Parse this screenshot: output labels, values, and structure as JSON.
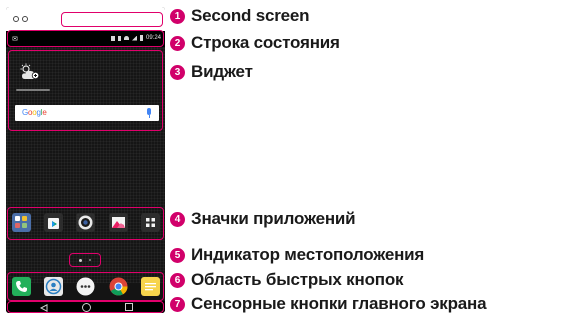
{
  "status_bar": {
    "time": "09:24"
  },
  "search": {
    "brand": "Google"
  },
  "colors": {
    "accent": "#d1006a",
    "phone_background": "#141414",
    "text": "#1a1a1a"
  },
  "icons": {
    "home_apps": [
      "lg-apps-folder-icon",
      "play-store-icon",
      "camera-icon",
      "gallery-icon",
      "apps-drawer-icon"
    ],
    "quick_keys": [
      "phone-icon",
      "contacts-icon",
      "messaging-icon",
      "chrome-icon",
      "memo-icon"
    ],
    "touch_keys": [
      "back-icon",
      "home-icon",
      "recent-apps-icon"
    ]
  },
  "callouts": [
    {
      "number": "1",
      "text": "Second screen"
    },
    {
      "number": "2",
      "text": "Строка состояния"
    },
    {
      "number": "3",
      "text": "Виджет"
    },
    {
      "number": "4",
      "text": "Значки приложений"
    },
    {
      "number": "5",
      "text": "Индикатор местоположения"
    },
    {
      "number": "6",
      "text": "Область быстрых кнопок"
    },
    {
      "number": "7",
      "text": "Сенсорные кнопки главного экрана"
    }
  ]
}
